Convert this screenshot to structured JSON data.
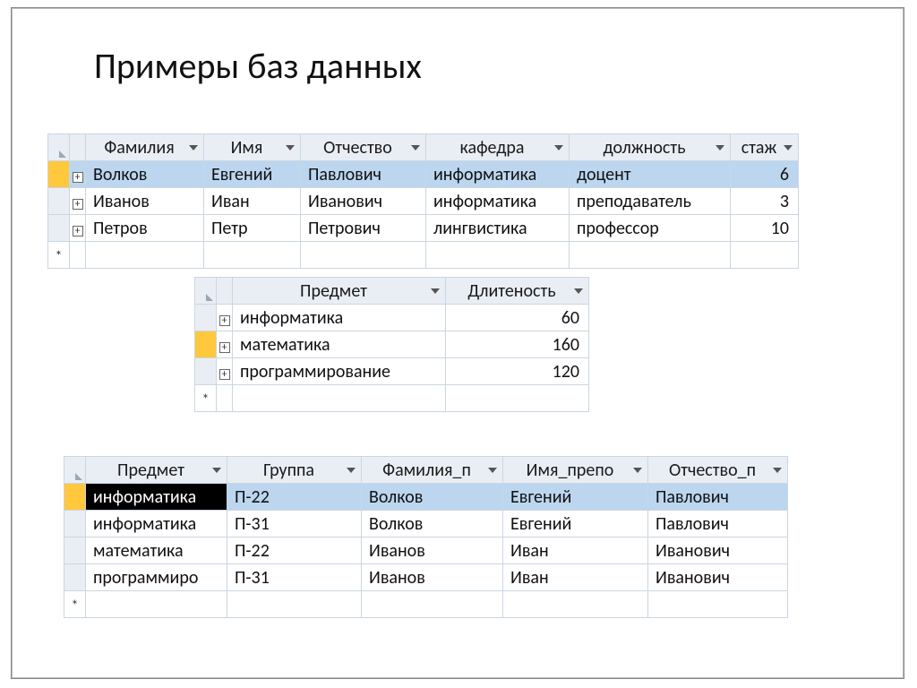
{
  "title": "Примеры баз данных",
  "icons": {
    "expand": "+",
    "newrow": "*"
  },
  "table1": {
    "headers": [
      "Фамилия",
      "Имя",
      "Отчество",
      "кафедра",
      "должность",
      "стаж"
    ],
    "rows": [
      {
        "selected": true,
        "cells": [
          "Волков",
          "Евгений",
          "Павлович",
          "информатика",
          "доцент",
          "6"
        ]
      },
      {
        "selected": false,
        "cells": [
          "Иванов",
          "Иван",
          "Иванович",
          "информатика",
          "преподаватель",
          "3"
        ]
      },
      {
        "selected": false,
        "cells": [
          "Петров",
          "Петр",
          "Петрович",
          "лингвистика",
          "профессор",
          "10"
        ]
      }
    ]
  },
  "table2": {
    "headers": [
      "Предмет",
      "Длитеность"
    ],
    "rows": [
      {
        "active": false,
        "cells": [
          "информатика",
          "60"
        ]
      },
      {
        "active": true,
        "cells": [
          "математика",
          "160"
        ]
      },
      {
        "active": false,
        "cells": [
          "программирование",
          "120"
        ]
      }
    ]
  },
  "table3": {
    "headers": [
      "Предмет",
      "Группа",
      "Фамилия_п",
      "Имя_препо",
      "Отчество_п"
    ],
    "rows": [
      {
        "selected": true,
        "edit": true,
        "cells": [
          "информатика",
          "П-22",
          "Волков",
          "Евгений",
          "Павлович"
        ]
      },
      {
        "selected": false,
        "edit": false,
        "cells": [
          "информатика",
          "П-31",
          "Волков",
          "Евгений",
          "Павлович"
        ]
      },
      {
        "selected": false,
        "edit": false,
        "cells": [
          "математика",
          "П-22",
          "Иванов",
          "Иван",
          "Иванович"
        ]
      },
      {
        "selected": false,
        "edit": false,
        "cells": [
          "программиро",
          "П-31",
          "Иванов",
          "Иван",
          "Иванович"
        ]
      }
    ]
  }
}
